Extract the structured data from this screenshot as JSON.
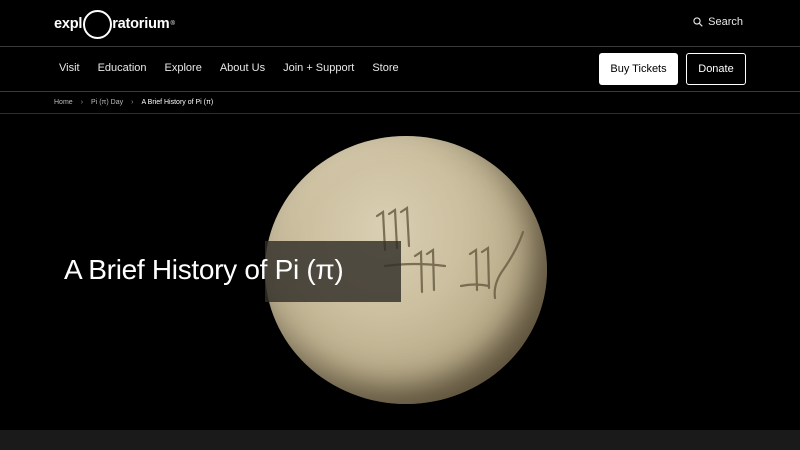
{
  "header": {
    "logo": {
      "left_text": "expl",
      "right_text": "ratorium",
      "reg_mark": "®"
    },
    "search": {
      "icon": "search-icon",
      "label": "Search"
    }
  },
  "nav": {
    "items": [
      {
        "label": "Visit"
      },
      {
        "label": "Education"
      },
      {
        "label": "Explore"
      },
      {
        "label": "About Us"
      },
      {
        "label": "Join + Support"
      },
      {
        "label": "Store"
      }
    ],
    "buy_tickets_label": "Buy Tickets",
    "donate_label": "Donate"
  },
  "breadcrumb": {
    "items": [
      "Home",
      "Pi (π) Day",
      "A Brief History of Pi (π)"
    ],
    "separator": "›"
  },
  "hero": {
    "title": "A Brief History of Pi (π)"
  },
  "colors": {
    "background": "#000000",
    "text": "#ffffff",
    "button_primary_bg": "#ffffff",
    "button_primary_text": "#000000"
  }
}
